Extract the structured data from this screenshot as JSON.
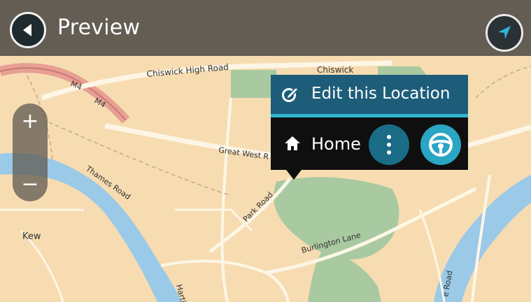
{
  "header": {
    "title": "Preview"
  },
  "zoom": {
    "in_label": "+",
    "out_label": "−"
  },
  "popup": {
    "edit_label": "Edit this Location",
    "home_label": "Home"
  },
  "map": {
    "roads": {
      "chiswick_high_road": "Chiswick High Road",
      "chiswick": "Chiswick",
      "m4_a": "M4",
      "m4_b": "M4",
      "great_west_road": "Great West R",
      "thames_road": "Thames Road",
      "park_road": "Park Road",
      "burlington_lane": "Burlington Lane",
      "kew": "Kew",
      "hartington": "Harti",
      "road_right": "e Road"
    }
  },
  "colors": {
    "land": "#f7dcb2",
    "water": "#9bc9e8",
    "park": "#a9c9a1",
    "motorway": "#e89f95",
    "edit_row": "#1d5d79",
    "accent": "#31b6d2",
    "drive_button": "#2aa5c3",
    "more_button": "#1a6c87"
  },
  "icons": {
    "back": "back-arrow-icon",
    "navigate": "navigation-arrow-icon",
    "edit": "edit-location-icon",
    "home": "home-icon",
    "more": "more-vertical-icon",
    "drive": "steering-wheel-icon"
  }
}
